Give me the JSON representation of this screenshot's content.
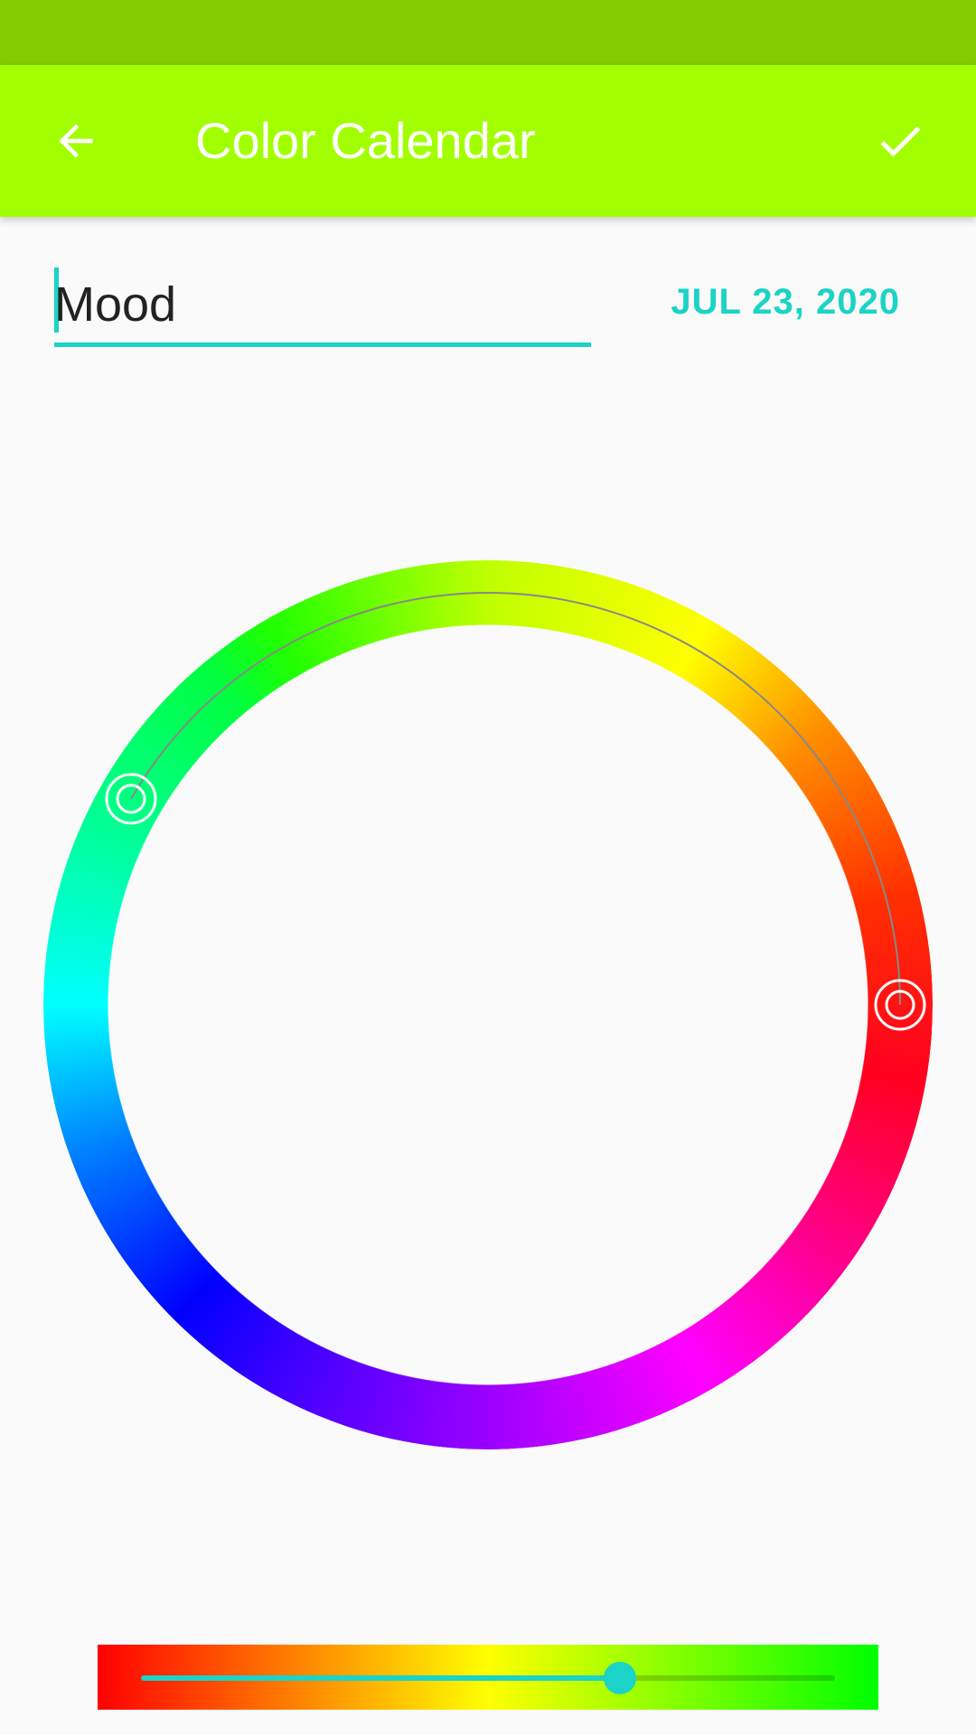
{
  "app_bar": {
    "title": "Color Calendar",
    "back_icon": "arrow-left-icon",
    "confirm_icon": "check-icon"
  },
  "form": {
    "name_value": "Mood",
    "name_placeholder": "",
    "date": "JUL 23, 2020"
  },
  "colors": {
    "status_bar": "#84cc00",
    "app_bar": "#a2ff00",
    "accent": "#1bd3c6",
    "background": "#fafafa"
  },
  "wheel": {
    "range_start_color": "#00ff00",
    "range_end_color": "#ff0000"
  },
  "slider": {
    "gradient": [
      "#ff0000",
      "#ffff00",
      "#00ff00"
    ],
    "value": 0.69
  }
}
